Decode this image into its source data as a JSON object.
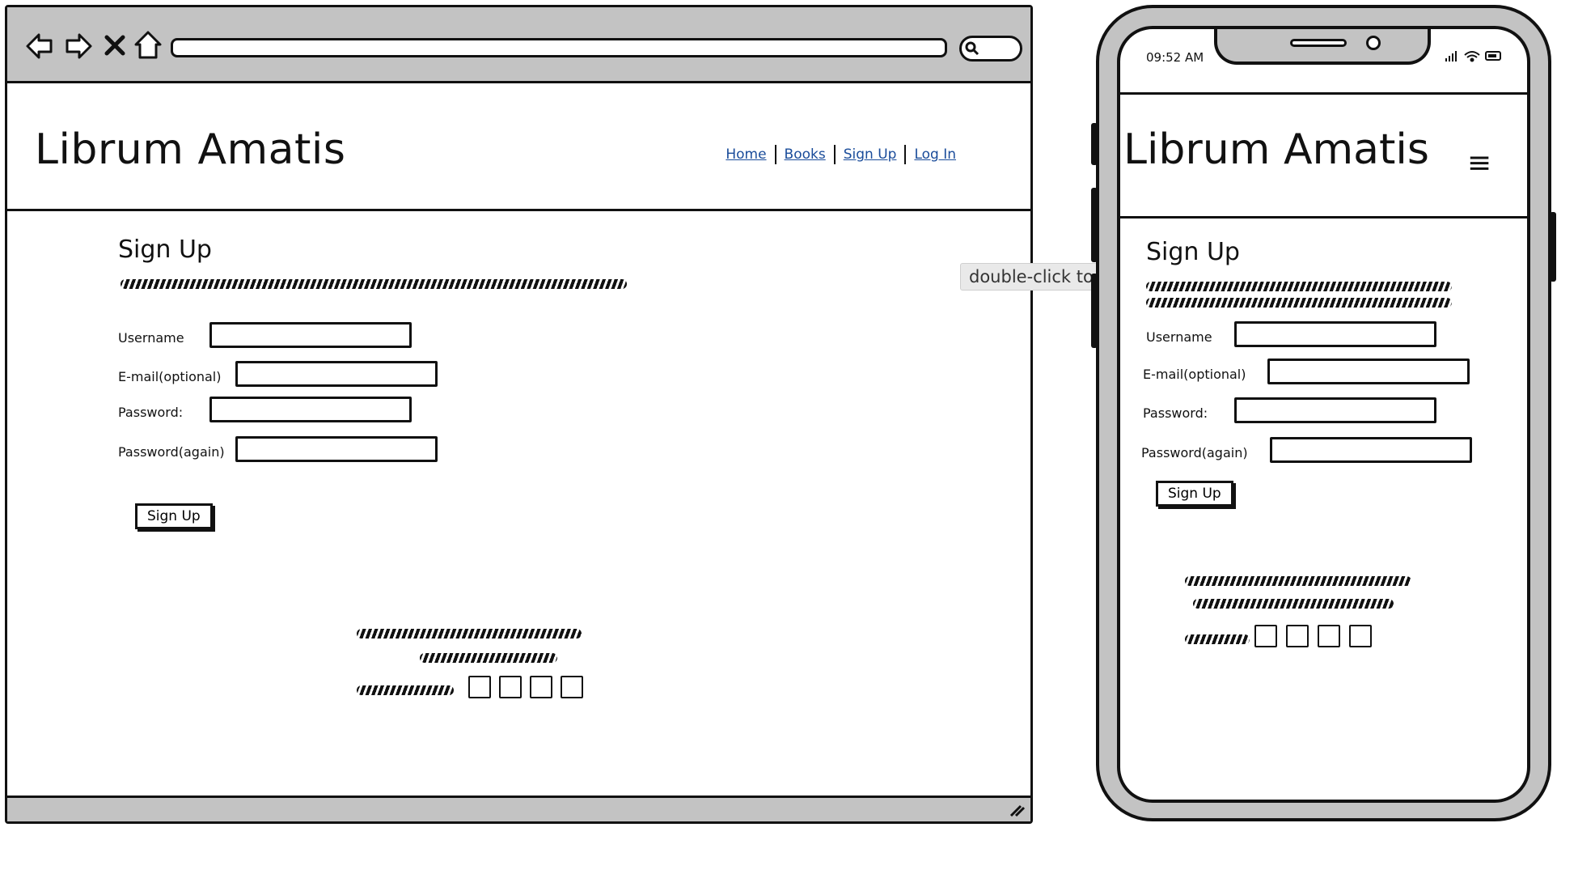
{
  "app": {
    "brand": "Librum Amatis"
  },
  "browser": {
    "nav_icons": [
      "back-arrow-icon",
      "forward-arrow-icon",
      "close-x-icon",
      "home-icon"
    ],
    "search_icon": "search-icon",
    "resize_icon": "resize-grip-icon"
  },
  "nav": {
    "items": [
      {
        "label": "Home"
      },
      {
        "label": "Books"
      },
      {
        "label": "Sign Up"
      },
      {
        "label": "Log In"
      }
    ]
  },
  "signup": {
    "title": "Sign Up",
    "username_label": "Username",
    "email_label": "E-mail(optional)",
    "password_label": "Password:",
    "password_again_label": "Password(again)",
    "submit_label": "Sign Up"
  },
  "tooltip": {
    "text": "double-click to edit"
  },
  "phone": {
    "time": "09:52 AM",
    "menu_icon": "≡"
  },
  "colors": {
    "frame": "#c3c3c3",
    "line": "#111111",
    "link": "#1a4c9a"
  }
}
